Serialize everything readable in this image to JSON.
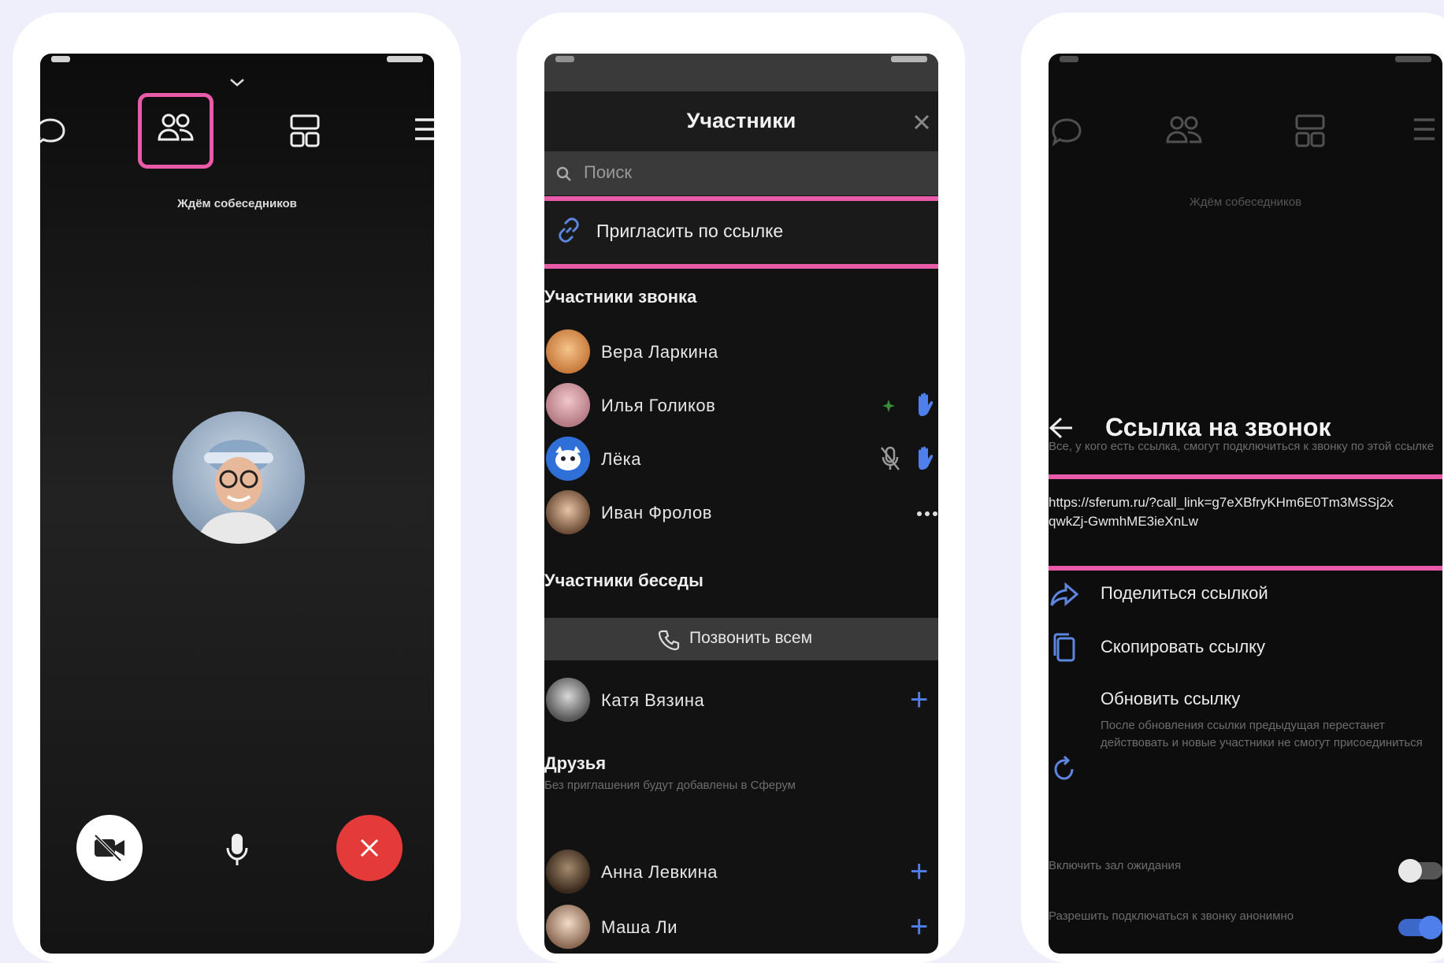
{
  "screen1": {
    "status_text": "Ждём собеседников"
  },
  "screen2": {
    "title": "Участники",
    "search_placeholder": "Поиск",
    "invite_link_label": "Пригласить по ссылке",
    "call_section": "Участники звонка",
    "call_members": [
      {
        "name": "Вера Ларкина"
      },
      {
        "name": "Илья Голиков"
      },
      {
        "name": "Лёка"
      },
      {
        "name": "Иван Фролов"
      }
    ],
    "chat_section": "Участники беседы",
    "call_all_label": "Позвонить всем",
    "chat_members": [
      {
        "name": "Катя Вязина"
      }
    ],
    "friends_section": "Друзья",
    "friends_subtitle": "Без приглашения будут добавлены в Сферум",
    "friends": [
      {
        "name": "Анна Левкина"
      },
      {
        "name": "Маша Ли"
      }
    ]
  },
  "screen3": {
    "status_text": "Ждём собеседников",
    "title": "Ссылка на звонок",
    "description": "Все, у кого есть ссылка, смогут подключиться к звонку по этой ссылке",
    "link_url": "https://sferum.ru/?call_link=g7eXBfryKHm6E0Tm3MSSj2xqwkZj-GwmhME3ieXnLw",
    "share_label": "Поделиться ссылкой",
    "copy_label": "Скопировать ссылку",
    "refresh_label": "Обновить ссылку",
    "refresh_desc": "После обновления ссылки предыдущая перестанет действовать и новые участники не смогут присоединиться",
    "toggle1_label": "Включить зал ожидания",
    "toggle2_label": "Разрешить подключаться к звонку анонимно"
  },
  "colors": {
    "accent_pink": "#e95aa8",
    "end_call_red": "#e53a3a",
    "link_blue": "#4f7fea",
    "background": "#eeeffb"
  }
}
